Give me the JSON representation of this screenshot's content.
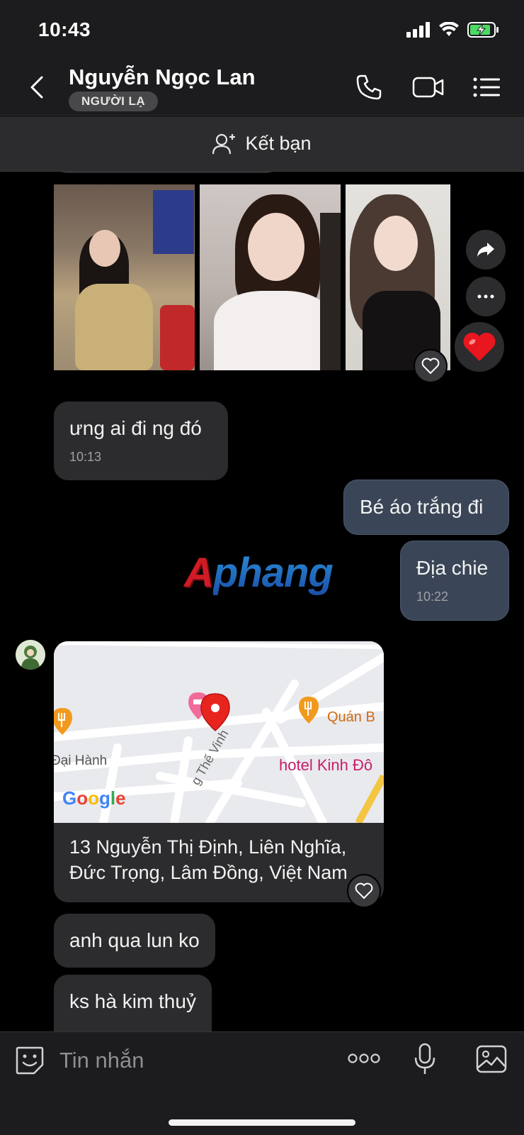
{
  "status_bar": {
    "time": "10:43"
  },
  "header": {
    "contact_name": "Nguyễn Ngọc Lan",
    "badge": "NGƯỜI LẠ",
    "icons": [
      "back-icon",
      "phone-icon",
      "video-call-icon",
      "menu-list-icon"
    ]
  },
  "friend_bar": {
    "label": "Kết bạn",
    "icon": "add-friend-icon"
  },
  "messages": [
    {
      "direction": "in",
      "type": "photos",
      "count": 3
    },
    {
      "direction": "in",
      "text": "ưng ai đi ng đó",
      "time": "10:13"
    },
    {
      "direction": "out",
      "text": "Bé áo trắng đi"
    },
    {
      "direction": "out",
      "text": "Địa chie",
      "time": "10:22"
    },
    {
      "direction": "in",
      "type": "location",
      "map_labels": {
        "poi_1": "Quán B",
        "poi_2": "hotel Kinh Đô",
        "street_1": "Đại Hành",
        "street_2": "g Thế Vinh",
        "logo": "Google"
      },
      "address": "13 Nguyễn Thị Định, Liên Nghĩa, Đức Trọng, Lâm Đồng, Việt Nam"
    },
    {
      "direction": "in",
      "text": "anh qua lun ko"
    },
    {
      "direction": "in",
      "text": "ks hà kim thuỷ"
    }
  ],
  "watermark": "Aphang",
  "input": {
    "placeholder": "Tin nhắn"
  },
  "colors": {
    "bubble_in": "#2c2c2e",
    "bubble_out": "#3a4657",
    "heart": "#e8161f"
  }
}
